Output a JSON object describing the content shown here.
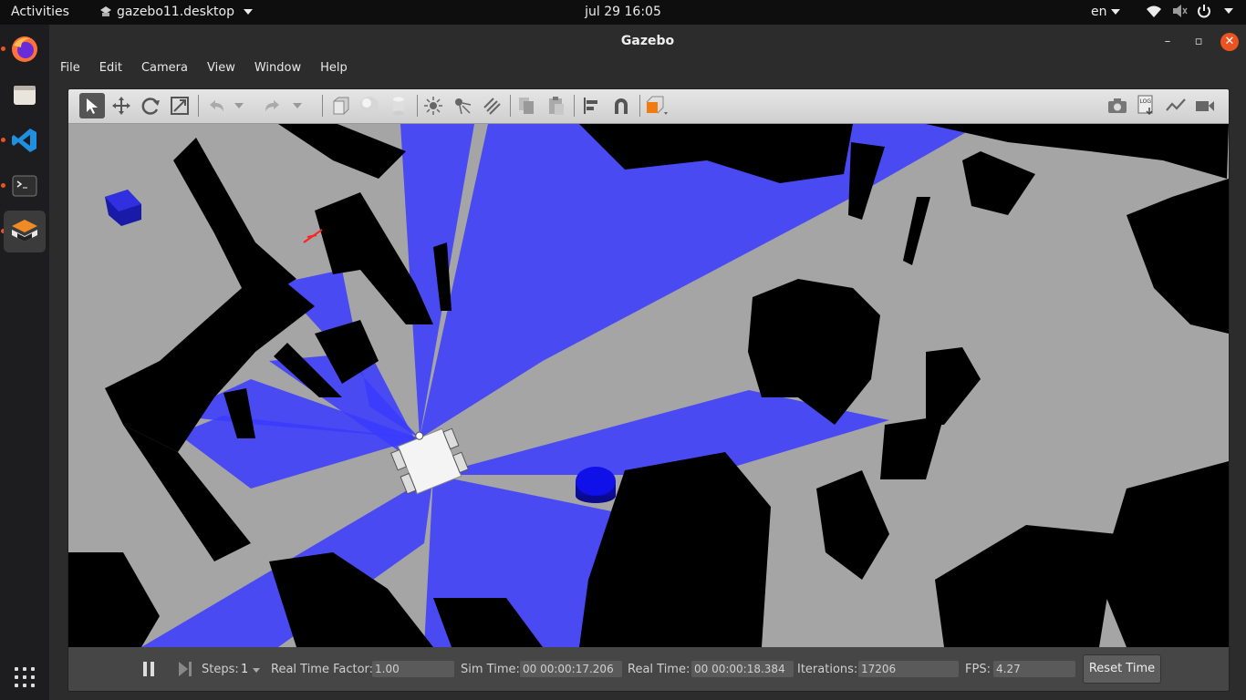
{
  "topbar": {
    "activities": "Activities",
    "app_menu": "gazebo11.desktop",
    "clock": "jul 29  16:05",
    "language": "en"
  },
  "dock": {
    "items": [
      "firefox-icon",
      "files-icon",
      "vscode-icon",
      "terminal-icon",
      "gazebo-icon"
    ],
    "active_item": "gazebo-icon"
  },
  "window": {
    "title": "Gazebo",
    "minimize": "–",
    "maximize": "▫",
    "close": "✕"
  },
  "menu": [
    "File",
    "Edit",
    "Camera",
    "View",
    "Window",
    "Help"
  ],
  "toolbar": {
    "selected_tool": "select-mode"
  },
  "bottom": {
    "steps_label": "Steps:",
    "steps_value": "1",
    "rtf_label": "Real Time Factor:",
    "rtf_value": "1.00",
    "sim_time_label": "Sim Time:",
    "sim_time_value": "00 00:00:17.206",
    "real_time_label": "Real Time:",
    "real_time_value": "00 00:00:18.384",
    "iterations_label": "Iterations:",
    "iterations_value": "17206",
    "fps_label": "FPS:",
    "fps_value": "4.27",
    "reset_button": "Reset Time"
  },
  "colors": {
    "laser": "#3a3aff",
    "ground": "#a5a5a5",
    "obstacle": "#000000",
    "accent": "#e95420"
  }
}
